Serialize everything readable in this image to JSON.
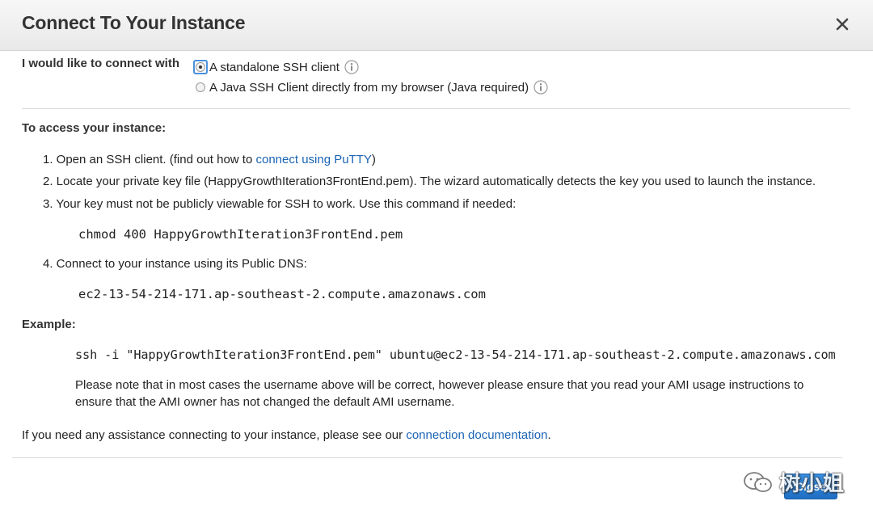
{
  "dialog": {
    "title": "Connect To Your Instance",
    "close_icon": "close-icon"
  },
  "connect": {
    "label": "I would like to connect with",
    "options": [
      {
        "label": "A standalone SSH client",
        "selected": true
      },
      {
        "label": "A Java SSH Client directly from my browser (Java required)",
        "selected": false
      }
    ],
    "info_icon": "info-icon"
  },
  "access": {
    "heading": "To access your instance:",
    "step1_prefix": "1. Open an SSH client. (find out how to ",
    "step1_link": "connect using PuTTY",
    "step1_suffix": ")",
    "step2": "2. Locate your private key file (HappyGrowthIteration3FrontEnd.pem). The wizard automatically detects the key you used to launch the instance.",
    "step3": "3. Your key must not be publicly viewable for SSH to work. Use this command if needed:",
    "chmod_command": "chmod 400 HappyGrowthIteration3FrontEnd.pem",
    "step4": "4. Connect to your instance using its Public DNS:",
    "public_dns": "ec2-13-54-214-171.ap-southeast-2.compute.amazonaws.com"
  },
  "example": {
    "heading": "Example:",
    "ssh_command": "ssh -i \"HappyGrowthIteration3FrontEnd.pem\" ubuntu@ec2-13-54-214-171.ap-southeast-2.compute.amazonaws.com",
    "note_line1": "Please note that in most cases the username above will be correct, however please ensure that you read your AMI usage instructions to",
    "note_line2": "ensure that the AMI owner has not changed the default AMI username."
  },
  "assistance": {
    "prefix": "If you need any assistance connecting to your instance, please see our ",
    "link": "connection documentation",
    "suffix": "."
  },
  "footer": {
    "close_label": "Close"
  },
  "watermark": {
    "text": "树小姐",
    "icon": "wechat-icon"
  },
  "colors": {
    "link": "#1a63b5",
    "primary_button": "#2a7fd4",
    "focus_ring": "#4a90e2"
  }
}
